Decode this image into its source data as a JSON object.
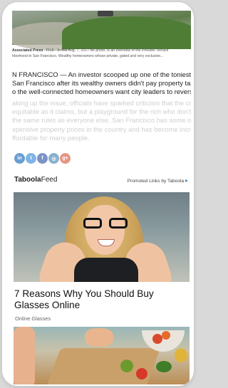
{
  "caption": {
    "credit": "Associated Press",
    "text_line1": " · FILE - In this Aug. 7, 2017 file photo, is an overview of the Presidio Terrace",
    "text_line2": "hborhood in San Francisco. Wealthy homeowners whose private, gated and very exclusive..."
  },
  "article": {
    "lines": [
      "N FRANCISCO — An investor scooped up one of the toniest private streets",
      "San Francisco after its wealthy owners didn't pay property taxes for years, a",
      "o the well-connected homeowners want city leaders to reverse Tuesda"
    ],
    "faded_lines": [
      "aking up the issue, officials have sparked criticism that the city is not as fa",
      "equitable as it claims, but a playground for the rich who don't have to pla",
      "the same rules as everyone else. San Francisco has some of the most",
      "xpensive property prices in the country and has become increasingly",
      "ffordable for many people."
    ]
  },
  "social": [
    {
      "name": "linkedin-icon",
      "glyph": "in",
      "color": "#6b9ed1"
    },
    {
      "name": "twitter-icon",
      "glyph": "t",
      "color": "#7fb5e6"
    },
    {
      "name": "facebook-icon",
      "glyph": "f",
      "color": "#7d93c6"
    },
    {
      "name": "instagram-icon",
      "glyph": "◎",
      "color": "#8ab0cf"
    },
    {
      "name": "google-plus-icon",
      "glyph": "g+",
      "color": "#e79583"
    }
  ],
  "taboola": {
    "logo_bold": "Taboola",
    "logo_rest": "Feed",
    "promoted": "Promoted Links by Taboola",
    "headline": "7 Reasons Why You Should Buy Glasses Online",
    "source": "Online Glasses"
  }
}
